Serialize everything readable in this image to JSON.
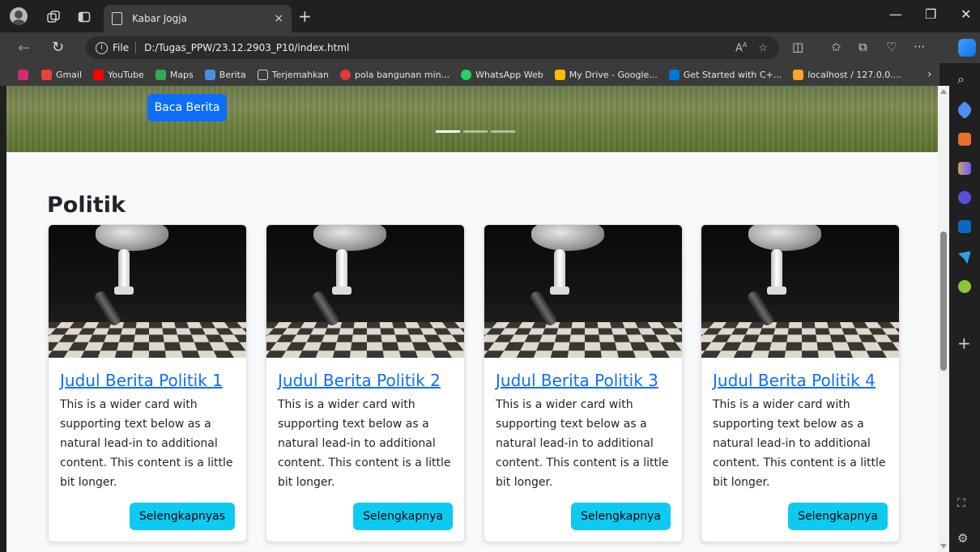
{
  "browser": {
    "tab_title": "Kabar Jogja",
    "tab_close": "×",
    "new_tab": "+",
    "address_label": "File",
    "address_url": "D:/Tugas_PPW/23.12.2903_P10/index.html",
    "reader_label": "A⁾",
    "window_minimize": "—",
    "window_restore": "❐",
    "window_close": "✕",
    "more_label": "···",
    "bookmarks_more": "›",
    "bookmarks": [
      {
        "label": "Gmail",
        "color": "#ea4335"
      },
      {
        "label": "YouTube",
        "color": "#ff0000"
      },
      {
        "label": "Maps",
        "color": "#34a853"
      },
      {
        "label": "Berita",
        "color": "#4a90e2"
      },
      {
        "label": "Terjemahkan",
        "color": "#3b3b3b"
      },
      {
        "label": "pola bangunan min...",
        "color": "#e53935"
      },
      {
        "label": "WhatsApp Web",
        "color": "#25d366"
      },
      {
        "label": "My Drive - Google...",
        "color": "#fbbc04"
      },
      {
        "label": "Get Started with C+...",
        "color": "#0078d4"
      },
      {
        "label": "localhost / 127.0.0....",
        "color": "#f5a623"
      }
    ]
  },
  "hero": {
    "button_label": "Baca Berita",
    "indicators": 3,
    "active_indicator": 1
  },
  "section": {
    "title": "Politik"
  },
  "cards": [
    {
      "title": "Judul Berita Politik 1",
      "text": "This is a wider card with supporting text below as a natural lead-in to additional content. This content is a little bit longer.",
      "button": "Selengkapnyas"
    },
    {
      "title": "Judul Berita Politik 2",
      "text": "This is a wider card with supporting text below as a natural lead-in to additional content. This content is a little bit longer.",
      "button": "Selengkapnya"
    },
    {
      "title": "Judul Berita Politik 3",
      "text": "This is a wider card with supporting text below as a natural lead-in to additional content. This content is a little bit longer.",
      "button": "Selengkapnya"
    },
    {
      "title": "Judul Berita Politik 4",
      "text": "This is a wider card with supporting text below as a natural lead-in to additional content. This content is a little bit longer.",
      "button": "Selengkapnya"
    }
  ],
  "colors": {
    "primary": "#0d6efd",
    "info": "#0dcaf0",
    "page_bg": "#f8f9fa"
  }
}
